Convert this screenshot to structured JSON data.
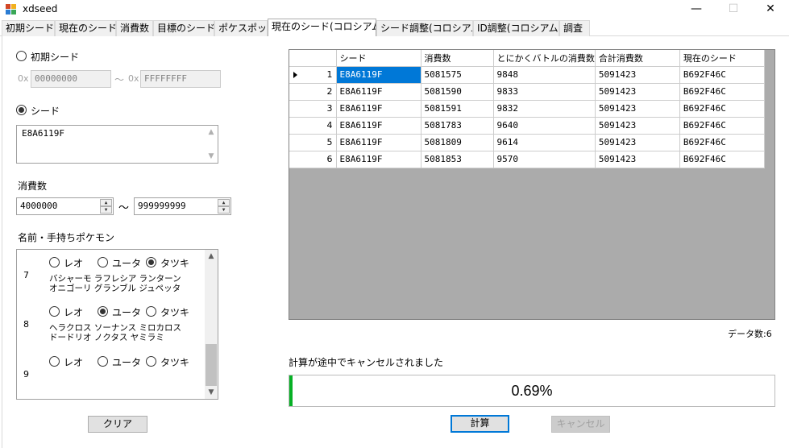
{
  "window": {
    "title": "xdseed",
    "minimize": "—",
    "maximize": "☐",
    "close": "✕"
  },
  "tabs": [
    {
      "label": "初期シード"
    },
    {
      "label": "現在のシード"
    },
    {
      "label": "消費数"
    },
    {
      "label": "目標のシード"
    },
    {
      "label": "ポケスポット"
    },
    {
      "label": "現在のシード(コロシアム)"
    },
    {
      "label": "シード調整(コロシアム)"
    },
    {
      "label": "ID調整(コロシアム)"
    },
    {
      "label": "調査"
    }
  ],
  "active_tab_index": 5,
  "left": {
    "initial_seed_radio": "初期シード",
    "hex_prefix": "0x",
    "range_from": "00000000",
    "tilde": "〜",
    "range_to": "FFFFFFFF",
    "seed_radio": "シード",
    "seed_value": "E8A6119F",
    "consumption_label": "消費数",
    "consumption_min": "4000000",
    "consumption_max": "999999999",
    "party_label": "名前・手持ちポケモン",
    "groups": [
      {
        "number": "7",
        "options": [
          "レオ",
          "ユータ",
          "タツキ"
        ],
        "selected": 2,
        "pokemon_line1": "バシャーモ ラフレシア ランターン",
        "pokemon_line2": "オニゴーリ グランブル ジュペッタ"
      },
      {
        "number": "8",
        "options": [
          "レオ",
          "ユータ",
          "タツキ"
        ],
        "selected": 1,
        "pokemon_line1": "ヘラクロス ソーナンス ミロカロス",
        "pokemon_line2": "ドードリオ ノクタス ヤミラミ"
      },
      {
        "number": "9",
        "options": [
          "レオ",
          "ユータ",
          "タツキ"
        ],
        "selected": -1,
        "pokemon_line1": "",
        "pokemon_line2": ""
      }
    ],
    "clear_button": "クリア"
  },
  "results": {
    "columns": [
      "シード",
      "消費数",
      "とにかくバトルの消費数",
      "合計消費数",
      "現在のシード"
    ],
    "rows": [
      {
        "n": "1",
        "cells": [
          "E8A6119F",
          "5081575",
          "9848",
          "5091423",
          "B692F46C"
        ]
      },
      {
        "n": "2",
        "cells": [
          "E8A6119F",
          "5081590",
          "9833",
          "5091423",
          "B692F46C"
        ]
      },
      {
        "n": "3",
        "cells": [
          "E8A6119F",
          "5081591",
          "9832",
          "5091423",
          "B692F46C"
        ]
      },
      {
        "n": "4",
        "cells": [
          "E8A6119F",
          "5081783",
          "9640",
          "5091423",
          "B692F46C"
        ]
      },
      {
        "n": "5",
        "cells": [
          "E8A6119F",
          "5081809",
          "9614",
          "5091423",
          "B692F46C"
        ]
      },
      {
        "n": "6",
        "cells": [
          "E8A6119F",
          "5081853",
          "9570",
          "5091423",
          "B692F46C"
        ]
      }
    ],
    "count_label": "データ数:6"
  },
  "status_text": "計算が途中でキャンセルされました",
  "progress": {
    "text": "0.69%",
    "fraction": 0.0069,
    "color": "#06b025"
  },
  "buttons": {
    "calculate": "計算",
    "cancel": "キャンセル"
  },
  "colors": {
    "selection": "#0078d7",
    "grid_background": "#ababab"
  }
}
